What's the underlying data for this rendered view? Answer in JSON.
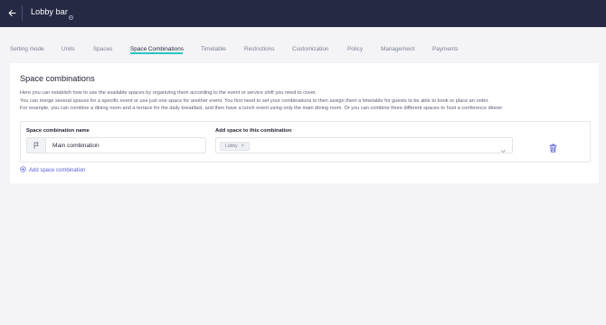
{
  "header": {
    "title": "Lobby bar",
    "back_icon": "arrow-left-icon",
    "title_icon": "settings-icon"
  },
  "tabs": [
    {
      "label": "Setting mode",
      "active": false
    },
    {
      "label": "Units",
      "active": false
    },
    {
      "label": "Spaces",
      "active": false
    },
    {
      "label": "Space Combinations",
      "active": true
    },
    {
      "label": "Timetable",
      "active": false
    },
    {
      "label": "Restrictions",
      "active": false
    },
    {
      "label": "Customization",
      "active": false
    },
    {
      "label": "Policy",
      "active": false
    },
    {
      "label": "Management",
      "active": false
    },
    {
      "label": "Payments",
      "active": false
    }
  ],
  "main": {
    "title": "Space combinations",
    "description": [
      "Here you can establish how to use the available spaces by organizing them according to the event or service shift you need to cover.",
      "You can merge several spaces for a specific event or use just one space for another event. You first need to set your combinations to then assign them a timetable for guests to be able to book or place an order.",
      "For example, you can combine a dining room and a terrace for the daily breakfast, and then have a lunch event using only the main dining room. Or you can combine three different spaces to host a conference dinner."
    ],
    "combination": {
      "name_label": "Space combination name",
      "name_value": "Main combination",
      "spaces_label": "Add space to this combination",
      "selected_spaces": [
        "Lobby"
      ],
      "chip_remove": "×"
    },
    "add_label": "Add space combination"
  },
  "colors": {
    "topbar": "#262944",
    "accent_underline": "#2bc3c3",
    "link": "#5b5bd6",
    "trash": "#5b5bd6"
  }
}
